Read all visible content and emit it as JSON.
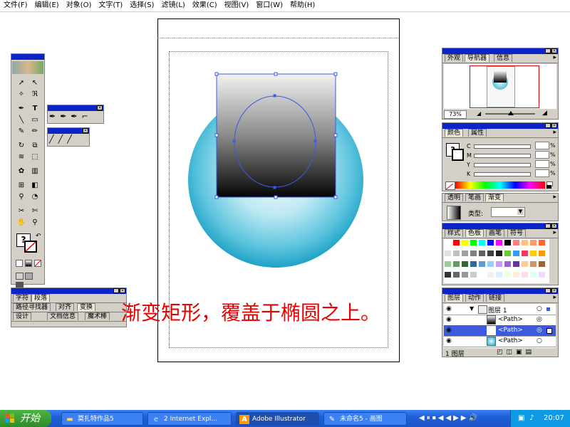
{
  "menu": [
    "文件(F)",
    "编辑(E)",
    "对象(O)",
    "文字(T)",
    "选择(S)",
    "滤镜(L)",
    "效果(C)",
    "视图(V)",
    "窗口(W)",
    "帮助(H)"
  ],
  "caption": "渐变矩形，覆盖于椭圆之上。",
  "colors": {
    "accent_red": "#e60000",
    "selection_blue": "#3c5ae0",
    "circle_light": "#e8f7fb",
    "circle_dark": "#1fa8cc",
    "title_blue": "#0a24c8"
  },
  "navigator": {
    "tabs": [
      "外观",
      "导航器",
      "信息"
    ],
    "zoom": "73%"
  },
  "color_panel": {
    "tabs": [
      "颜色",
      "属性"
    ],
    "channels": [
      "C",
      "M",
      "Y",
      "K"
    ],
    "pct": "%"
  },
  "gradient_panel": {
    "tabs": [
      "透明",
      "笔画",
      "渐变"
    ],
    "type_label": "类型:"
  },
  "swatch_panel": {
    "tabs": [
      "样式",
      "色板",
      "画笔",
      "符号"
    ]
  },
  "layers_panel": {
    "tabs": [
      "图层",
      "动作",
      "链接"
    ],
    "rows": [
      {
        "name": "图层 1"
      },
      {
        "name": "<Path>"
      },
      {
        "name": "<Path>"
      },
      {
        "name": "<Path>"
      }
    ],
    "footer": "1 图层"
  },
  "char_panel": {
    "row1": [
      "字符",
      "段落"
    ],
    "row2": [
      "路径寻找器",
      "对齐",
      "变换"
    ],
    "row3": [
      "设计",
      "文档信息",
      "魔术棒"
    ]
  },
  "toolbox": {
    "tools": [
      "selection-tool",
      "direct-selection-tool",
      "magic-wand-tool",
      "lasso-tool",
      "pen-tool",
      "type-tool",
      "line-tool",
      "rectangle-tool",
      "paintbrush-tool",
      "pencil-tool",
      "rotate-tool",
      "scale-tool",
      "warp-tool",
      "free-transform-tool",
      "symbol-sprayer-tool",
      "graph-tool",
      "mesh-tool",
      "gradient-tool",
      "eyedropper-tool",
      "blend-tool",
      "scissors-tool",
      "slice-tool",
      "hand-tool",
      "zoom-tool"
    ],
    "fill_stroke_label": "?"
  },
  "taskbar": {
    "start": "开始",
    "tasks": [
      "莫扎特作品5",
      "2 Internet Expl...",
      "Adobe Illustrator",
      "未命名5 - 画图"
    ],
    "clock": "20:07"
  }
}
